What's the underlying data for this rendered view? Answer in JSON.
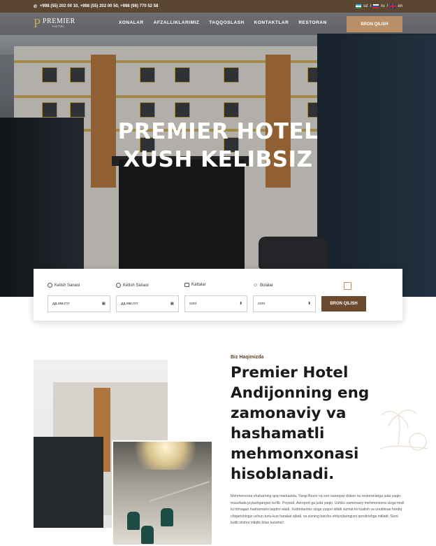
{
  "topbar": {
    "phones": "+998 (55) 202 00 10, +998 (55) 202 00 50, +998 (98) 770 52 58",
    "langs": [
      {
        "code": "uz",
        "sep": "/"
      },
      {
        "code": "ru",
        "sep": "/"
      },
      {
        "code": "en",
        "sep": ""
      }
    ]
  },
  "nav": {
    "logo_name": "PREMIER",
    "logo_sub": "HOTEL",
    "menu": [
      "XONALAR",
      "AFZALLIKLARIMIZ",
      "TAQQOSLASH",
      "KONTAKTLAR",
      "RESTORAN"
    ],
    "button": "BRON QILISH"
  },
  "hero": {
    "line1": "PREMIER HOTEL",
    "line2": "XUSH KELIBSIZ"
  },
  "booking": {
    "fields": [
      {
        "label": "Kelish Sanasi",
        "value": "дд.мм.гггг",
        "icon": "calendar-icon"
      },
      {
        "label": "Ketish Sanasi",
        "value": "дд.мм.гггг",
        "icon": "calendar-icon"
      },
      {
        "label": "Kattalar",
        "value": "soni",
        "icon": "people-icon"
      },
      {
        "label": "Bolalar",
        "value": "soni",
        "icon": "child-icon"
      }
    ],
    "button": "BRON QILISH"
  },
  "about": {
    "kicker": "Biz Haqimizda",
    "title": "Premier Hotel Andijonning eng zamonaviy va hashamatli mehmonxonasi hisoblanadi.",
    "text": "Mehmonxona shaharning qoq markazida, Yangi Bozor va son-sanoqsiz dokon va restoranlarga juda yaqin masofada joylashgangan bo'lib. Poyezd, Aeroport ga juda yaqin. Ushbu zamonaviy mehmonxona sizga misli ko'rilmagan hashamatni taqdim etadi. Xodimlarimiz sizga yuqori sifatli xizmat ko'rsatish va unutilmas hordiq chiqarishingiz uchun tunu-kun harakat qiladi. va sizning barcha ehtiyojlaringizni qondirishga intiladi. Sizni kutib olishni intiqlik bilan kutamiz!"
  },
  "colors": {
    "brand_dark": "#5b4632",
    "accent": "#b88f66",
    "button": "#6b4a2e"
  }
}
